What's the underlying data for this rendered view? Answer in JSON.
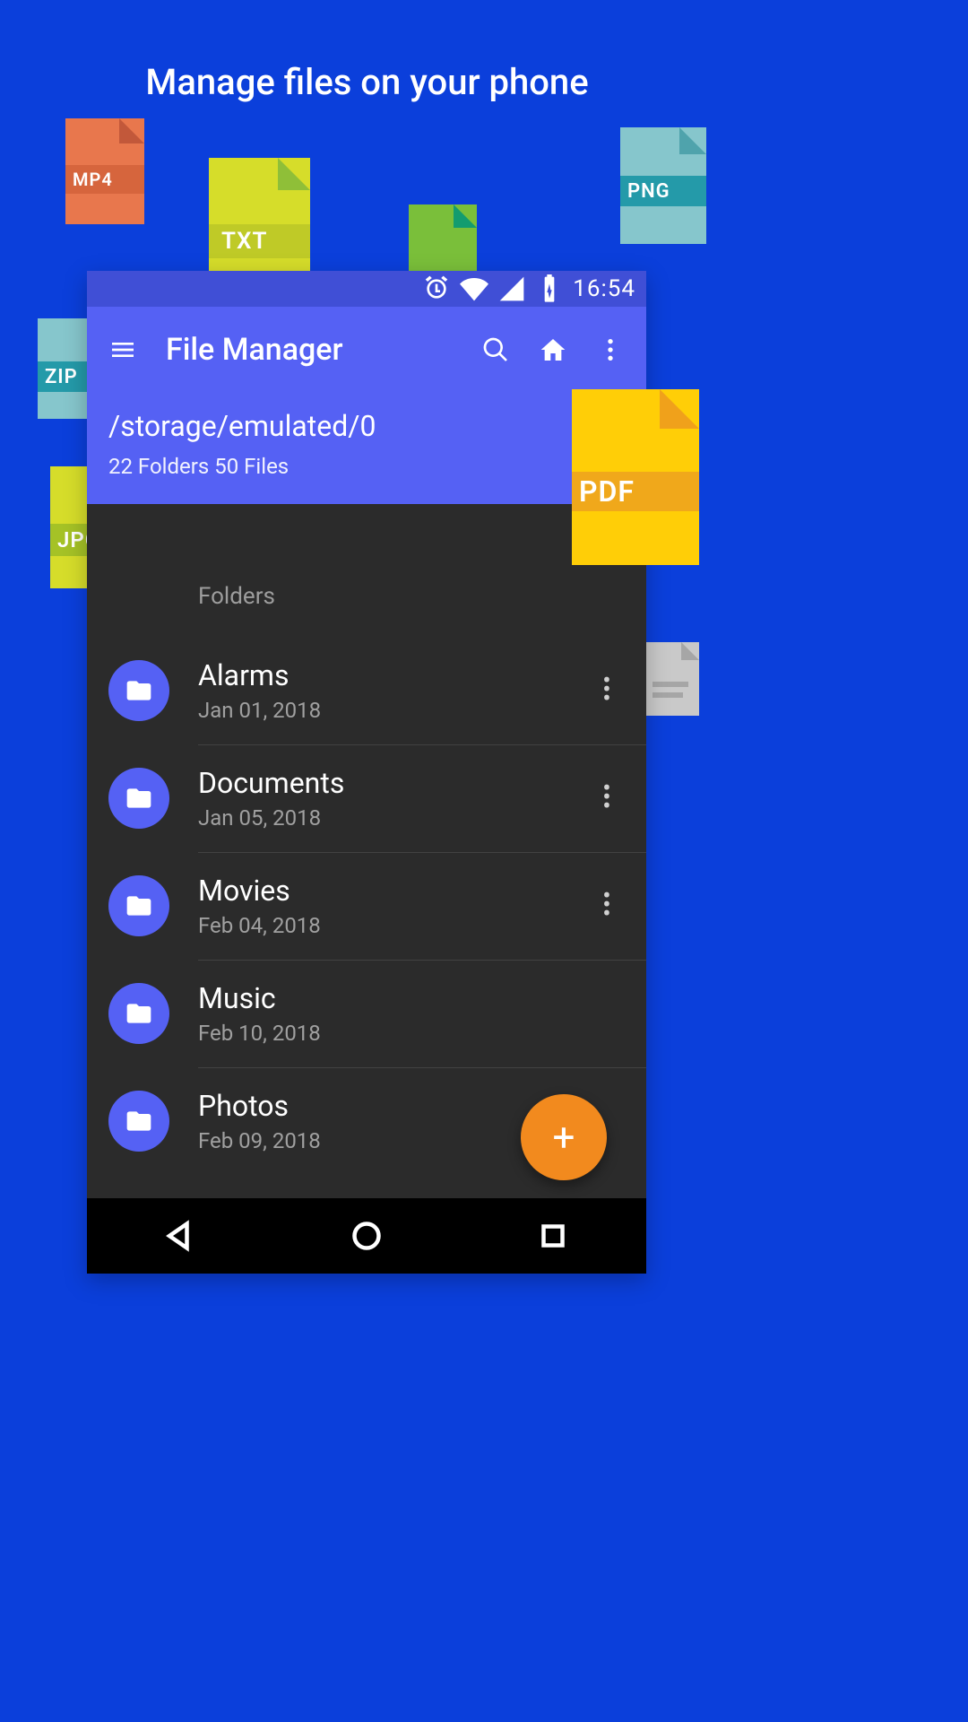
{
  "headline": "Manage files on your phone",
  "badges": {
    "mp4": "MP4",
    "txt": "TXT",
    "png": "PNG",
    "zip": "ZIP",
    "jpg": "JPG",
    "pdf": "PDF"
  },
  "status": {
    "time": "16:54"
  },
  "appbar": {
    "title": "File Manager",
    "path": "/storage/emulated/0",
    "stats": "22 Folders 50 Files"
  },
  "list": {
    "section": "Folders",
    "items": [
      {
        "name": "Alarms",
        "date": "Jan 01, 2018"
      },
      {
        "name": "Documents",
        "date": "Jan 05, 2018"
      },
      {
        "name": "Movies",
        "date": "Feb 04, 2018"
      },
      {
        "name": "Music",
        "date": "Feb 10, 2018"
      },
      {
        "name": "Photos",
        "date": "Feb 09, 2018"
      }
    ]
  },
  "colors": {
    "background": "#0b3fdb",
    "primary": "#5561f4",
    "primaryDark": "#404fd6",
    "surface": "#2b2b2b",
    "fab": "#f28a1e"
  }
}
